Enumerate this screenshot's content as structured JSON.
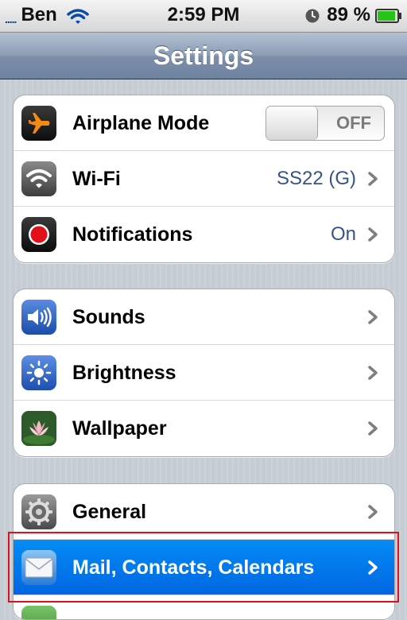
{
  "status_bar": {
    "carrier": "Ben",
    "signal_dots": ".....",
    "time": "2:59 PM",
    "battery": "89 %"
  },
  "nav": {
    "title": "Settings"
  },
  "groups": [
    {
      "items": [
        {
          "label": "Airplane Mode",
          "toggle_label": "OFF",
          "icon": "airplane-icon"
        },
        {
          "label": "Wi-Fi",
          "value": "SS22 (G)",
          "icon": "wifi-icon"
        },
        {
          "label": "Notifications",
          "value": "On",
          "icon": "notifications-icon"
        }
      ]
    },
    {
      "items": [
        {
          "label": "Sounds",
          "icon": "sounds-icon"
        },
        {
          "label": "Brightness",
          "icon": "brightness-icon"
        },
        {
          "label": "Wallpaper",
          "icon": "wallpaper-icon"
        }
      ]
    },
    {
      "items": [
        {
          "label": "General",
          "icon": "gear-icon"
        },
        {
          "label": "Mail, Contacts, Calendars",
          "icon": "mail-icon",
          "selected": true
        }
      ]
    }
  ],
  "colors": {
    "selected_row": "#0170e8",
    "value_text": "#385487",
    "highlight": "#e00f1b"
  }
}
